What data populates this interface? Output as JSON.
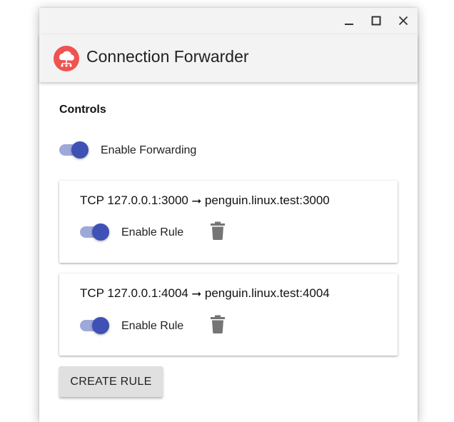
{
  "app": {
    "title": "Connection Forwarder",
    "logo_icon": "cloud-network-icon",
    "brand_color": "#ef5350"
  },
  "window_controls": {
    "minimize_icon": "minimize-icon",
    "maximize_icon": "maximize-icon",
    "close_icon": "close-icon"
  },
  "controls": {
    "heading": "Controls",
    "enable_forwarding_label": "Enable Forwarding",
    "enable_forwarding_on": true
  },
  "rules": [
    {
      "text": "TCP 127.0.0.1:3000 ⭢ penguin.linux.test:3000",
      "enable_label": "Enable Rule",
      "enabled": true,
      "delete_icon": "trash-icon"
    },
    {
      "text": "TCP 127.0.0.1:4004 ⭢ penguin.linux.test:4004",
      "enable_label": "Enable Rule",
      "enabled": true,
      "delete_icon": "trash-icon"
    }
  ],
  "create_rule_label": "CREATE RULE",
  "colors": {
    "toggle_thumb": "#3f51b5",
    "toggle_track": "#9fa8da",
    "trash": "#757575"
  }
}
